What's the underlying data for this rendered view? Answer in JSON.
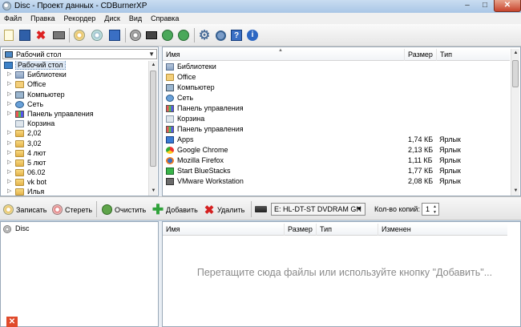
{
  "window": {
    "title": "Disc - Проект данных - CDBurnerXP"
  },
  "menu": [
    "Файл",
    "Правка",
    "Рекордер",
    "Диск",
    "Вид",
    "Справка"
  ],
  "tree": {
    "combo_label": "Рабочий стол",
    "items": [
      {
        "label": "Рабочий стол",
        "icon": "desktop-icon",
        "selected": true
      },
      {
        "label": "Библиотеки",
        "icon": "libraries-icon"
      },
      {
        "label": "Office",
        "icon": "user-folder-icon"
      },
      {
        "label": "Компьютер",
        "icon": "computer-icon"
      },
      {
        "label": "Сеть",
        "icon": "network-icon"
      },
      {
        "label": "Панель управления",
        "icon": "control-panel-icon"
      },
      {
        "label": "Корзина",
        "icon": "recycle-bin-icon"
      },
      {
        "label": "2,02",
        "icon": "folder-icon"
      },
      {
        "label": "3,02",
        "icon": "folder-icon"
      },
      {
        "label": "4 лют",
        "icon": "folder-icon"
      },
      {
        "label": "5 лют",
        "icon": "folder-icon"
      },
      {
        "label": "06.02",
        "icon": "folder-icon"
      },
      {
        "label": "vk bot",
        "icon": "folder-icon"
      },
      {
        "label": "Илья",
        "icon": "folder-icon"
      }
    ]
  },
  "files": {
    "columns": {
      "name": "Имя",
      "size": "Размер",
      "type": "Тип"
    },
    "rows": [
      {
        "name": "Библиотеки",
        "size": "",
        "type": "",
        "icon": "libraries-icon"
      },
      {
        "name": "Office",
        "size": "",
        "type": "",
        "icon": "user-folder-icon"
      },
      {
        "name": "Компьютер",
        "size": "",
        "type": "",
        "icon": "computer-icon"
      },
      {
        "name": "Сеть",
        "size": "",
        "type": "",
        "icon": "network-icon"
      },
      {
        "name": "Панель управления",
        "size": "",
        "type": "",
        "icon": "control-panel-icon"
      },
      {
        "name": "Корзина",
        "size": "",
        "type": "",
        "icon": "recycle-bin-icon"
      },
      {
        "name": "Панель управления",
        "size": "",
        "type": "",
        "icon": "control-panel-icon"
      },
      {
        "name": "Apps",
        "size": "1,74 КБ",
        "type": "Ярлык",
        "icon": "apps-icon"
      },
      {
        "name": "Google Chrome",
        "size": "2,13 КБ",
        "type": "Ярлык",
        "icon": "chrome-icon"
      },
      {
        "name": "Mozilla Firefox",
        "size": "1,11 КБ",
        "type": "Ярлык",
        "icon": "firefox-icon"
      },
      {
        "name": "Start BlueStacks",
        "size": "1,77 КБ",
        "type": "Ярлык",
        "icon": "bluestacks-icon"
      },
      {
        "name": "VMware Workstation",
        "size": "2,08 КБ",
        "type": "Ярлык",
        "icon": "vmware-icon"
      }
    ]
  },
  "actions": {
    "burn": "Записать",
    "erase": "Стереть",
    "clear": "Очистить",
    "add": "Добавить",
    "delete": "Удалить",
    "drive": "E: HL-DT-ST DVDRAM GH",
    "copies_label": "Кол-во копий:",
    "copies_value": "1"
  },
  "disc": {
    "label": "Disc"
  },
  "compilation": {
    "columns": {
      "name": "Имя",
      "size": "Размер",
      "type": "Тип",
      "modified": "Изменен"
    },
    "hint": "Перетащите сюда файлы или используйте кнопку \"Добавить\"..."
  }
}
